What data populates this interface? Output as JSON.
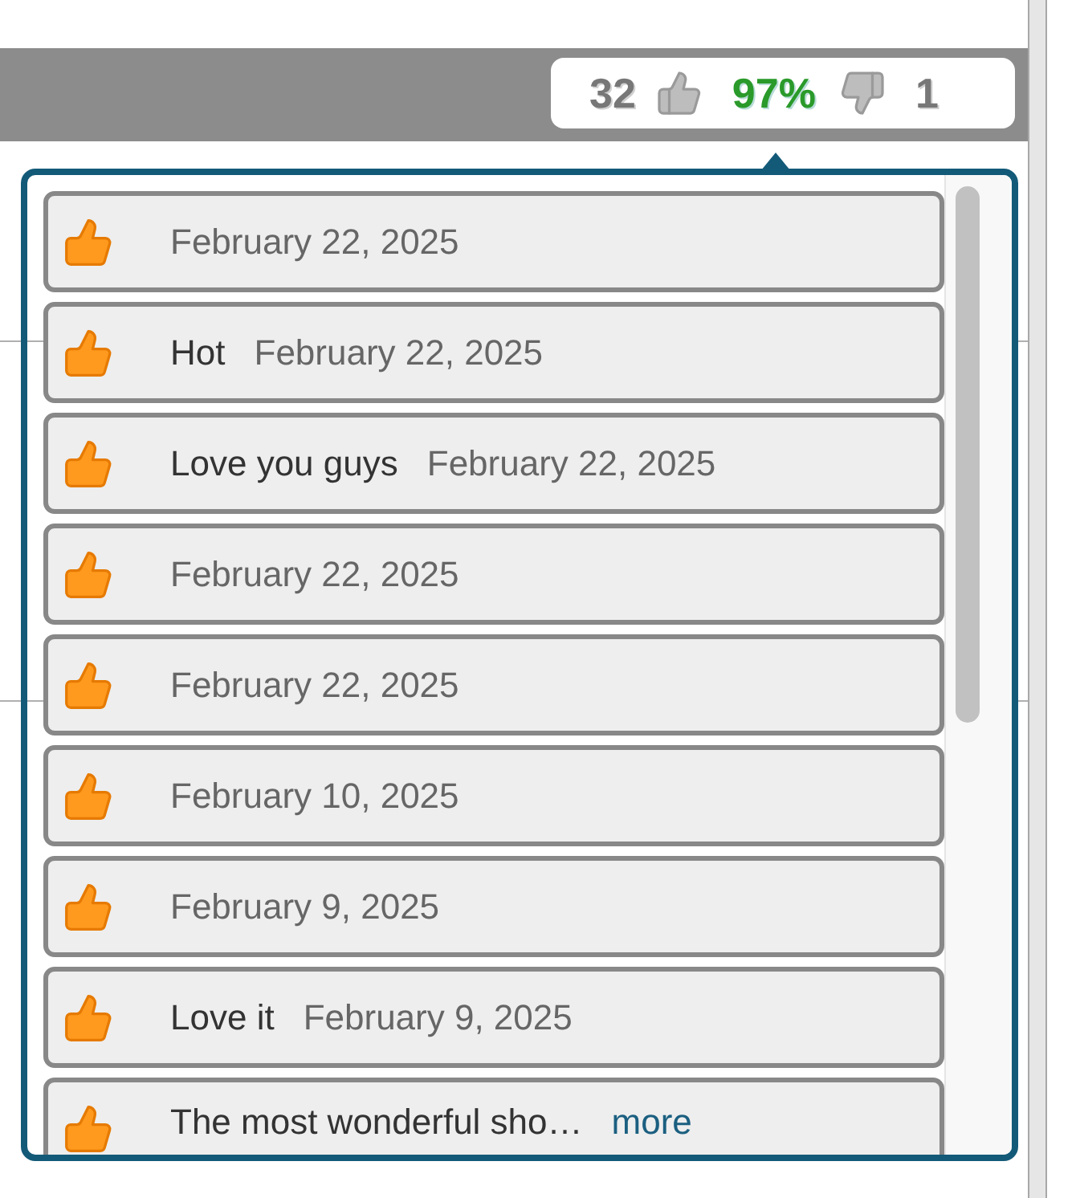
{
  "rating": {
    "likes": "32",
    "percent": "97%",
    "dislikes": "1"
  },
  "reactions": [
    {
      "date": "February 22, 2025"
    },
    {
      "comment": "Hot",
      "date": "February 22, 2025"
    },
    {
      "comment": "Love you guys",
      "date": "February 22, 2025"
    },
    {
      "date": "February 22, 2025"
    },
    {
      "date": "February 22, 2025"
    },
    {
      "date": "February 10, 2025"
    },
    {
      "date": "February 9, 2025"
    },
    {
      "comment": "Love it",
      "date": "February 9, 2025"
    },
    {
      "comment": "The most wonderful sho…",
      "more_link": "more"
    }
  ]
}
